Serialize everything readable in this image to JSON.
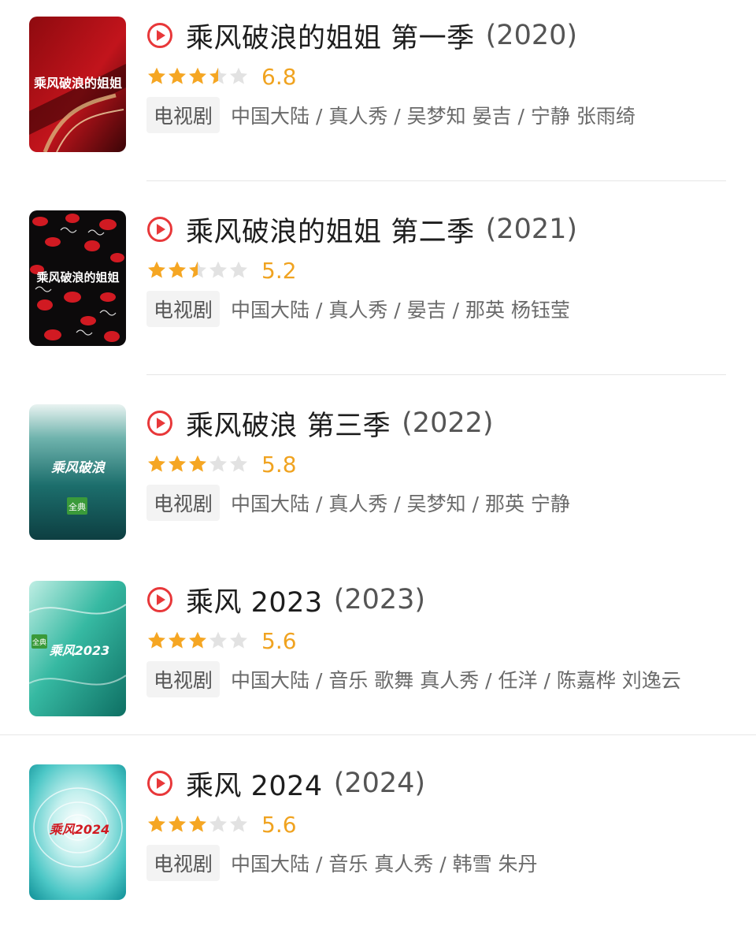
{
  "colors": {
    "star_on": "#f5a623",
    "star_off": "#e2e2e2",
    "score": "#f0a320",
    "play": "#e8383a"
  },
  "items": [
    {
      "title": "乘风破浪的姐姐 第一季",
      "year": "(2020)",
      "score": "6.8",
      "stars": 3.5,
      "tag": "电视剧",
      "meta": "中国大陆 / 真人秀 / 吴梦知 晏吉 / 宁静 张雨绮",
      "poster_text": "乘风破浪的姐姐"
    },
    {
      "title": "乘风破浪的姐姐 第二季",
      "year": "(2021)",
      "score": "5.2",
      "stars": 2.5,
      "tag": "电视剧",
      "meta": "中国大陆 / 真人秀 / 晏吉 / 那英 杨钰莹",
      "poster_text": "乘风破浪的姐姐"
    },
    {
      "title": "乘风破浪 第三季",
      "year": "(2022)",
      "score": "5.8",
      "stars": 3,
      "tag": "电视剧",
      "meta": "中国大陆 / 真人秀 / 吴梦知 / 那英 宁静",
      "poster_text": "乘风破浪",
      "poster_badge": "全典"
    },
    {
      "title": "乘风 2023",
      "year": "(2023)",
      "score": "5.6",
      "stars": 3,
      "tag": "电视剧",
      "meta": "中国大陆 / 音乐 歌舞 真人秀 / 任洋 / 陈嘉桦 刘逸云",
      "poster_text": "乘风2023",
      "poster_badge": "全典"
    },
    {
      "title": "乘风 2024",
      "year": "(2024)",
      "score": "5.6",
      "stars": 3,
      "tag": "电视剧",
      "meta": "中国大陆 / 音乐 真人秀 / 韩雪 朱丹",
      "poster_text": "乘风2024"
    }
  ]
}
